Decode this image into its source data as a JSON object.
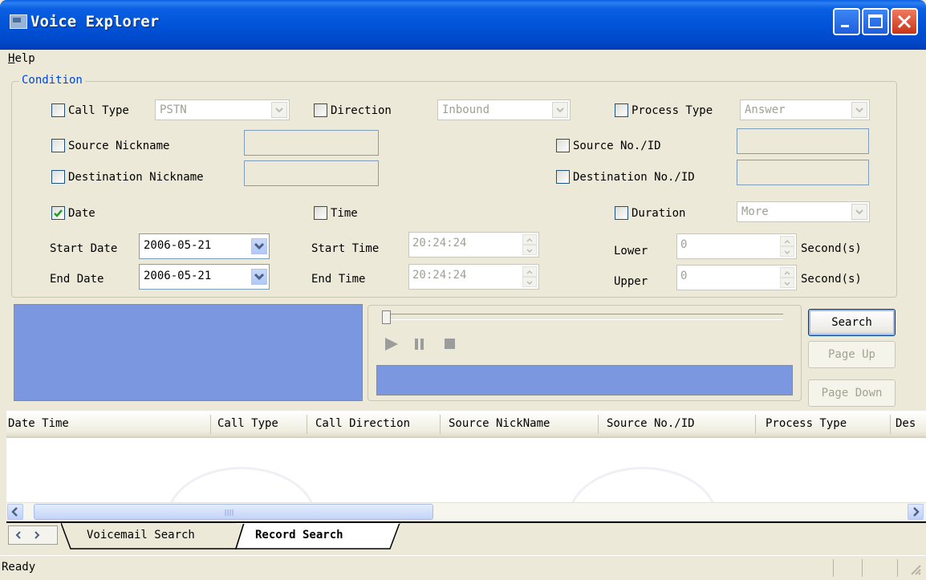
{
  "window": {
    "title": "Voice Explorer",
    "accent": "#0054e3",
    "close_color": "#e04b2a"
  },
  "menu": {
    "help_accel": "H",
    "help_rest": "elp"
  },
  "condition": {
    "title": "Condition",
    "call_type": {
      "label": "Call Type",
      "checked": false,
      "value": "PSTN"
    },
    "direction": {
      "label": "Direction",
      "checked": false,
      "value": "Inbound"
    },
    "process_type": {
      "label": "Process Type",
      "checked": false,
      "value": "Answer"
    },
    "source_nickname": {
      "label": "Source Nickname",
      "checked": false,
      "value": ""
    },
    "source_no": {
      "label": "Source No./ID",
      "checked": false,
      "value": ""
    },
    "destination_nickname": {
      "label": "Destination Nickname",
      "checked": false,
      "value": ""
    },
    "destination_no": {
      "label": "Destination No./ID",
      "checked": false,
      "value": ""
    },
    "date": {
      "label": "Date",
      "checked": true
    },
    "time": {
      "label": "Time",
      "checked": false
    },
    "duration": {
      "label": "Duration",
      "checked": false,
      "value": "More"
    },
    "start_date": {
      "label": "Start Date",
      "value": "2006-05-21"
    },
    "end_date": {
      "label": "End Date",
      "value": "2006-05-21"
    },
    "start_time": {
      "label": "Start Time",
      "value": "20:24:24"
    },
    "end_time": {
      "label": "End Time",
      "value": "20:24:24"
    },
    "lower": {
      "label": "Lower",
      "value": "0",
      "unit": "Second(s)"
    },
    "upper": {
      "label": "Upper",
      "value": "0",
      "unit": "Second(s)"
    }
  },
  "player": {
    "seek_position": 0,
    "progress_color": "#7b97df"
  },
  "buttons": {
    "search": "Search",
    "page_up": "Page Up",
    "page_down": "Page Down"
  },
  "table": {
    "columns": [
      "Date Time",
      "Call Type",
      "Call Direction",
      "Source NickName",
      "Source No./ID",
      "Process Type",
      "Des"
    ],
    "rows": []
  },
  "tabs": [
    {
      "label": "Voicemail Search",
      "active": false
    },
    {
      "label": "Record Search",
      "active": true
    }
  ],
  "status": {
    "text": "Ready"
  }
}
